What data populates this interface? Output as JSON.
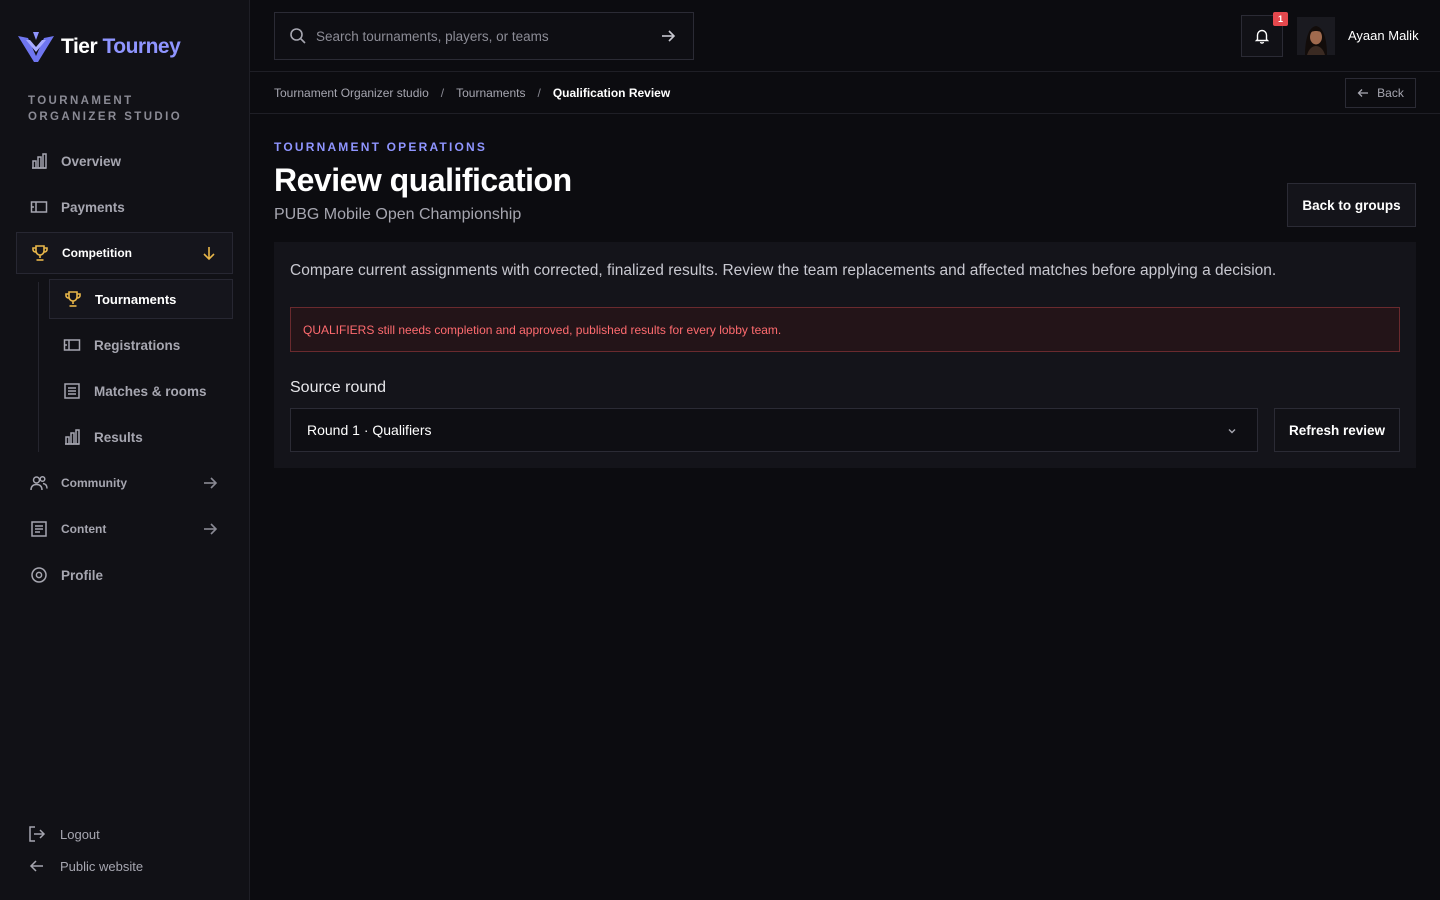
{
  "brand": {
    "name_part1": "Tier",
    "name_part2": "Tourney",
    "accent": "#8f95ff"
  },
  "sidebar": {
    "section_label": "TOURNAMENT ORGANIZER STUDIO",
    "items": [
      {
        "label": "Overview",
        "icon": "bar-chart-icon"
      },
      {
        "label": "Payments",
        "icon": "ticket-icon"
      },
      {
        "label": "Competition",
        "icon": "trophy-icon",
        "expanded": true
      },
      {
        "label": "Community",
        "icon": "users-icon"
      },
      {
        "label": "Content",
        "icon": "document-icon"
      },
      {
        "label": "Profile",
        "icon": "settings-icon"
      }
    ],
    "competition_sub": [
      {
        "label": "Tournaments",
        "icon": "trophy-icon",
        "active": true
      },
      {
        "label": "Registrations",
        "icon": "ticket-icon"
      },
      {
        "label": "Matches & rooms",
        "icon": "list-icon"
      },
      {
        "label": "Results",
        "icon": "bar-chart-icon"
      }
    ],
    "footer": {
      "logout": "Logout",
      "public_site": "Public website"
    }
  },
  "header": {
    "search_placeholder": "Search tournaments, players, or teams",
    "notification_count": "1",
    "user_name": "Ayaan Malik"
  },
  "breadcrumb": {
    "items": [
      "Tournament Organizer studio",
      "Tournaments",
      "Qualification Review"
    ],
    "separator": "/",
    "back_label": "Back"
  },
  "main": {
    "eyebrow": "TOURNAMENT OPERATIONS",
    "title": "Review qualification",
    "subtitle": "PUBG Mobile Open Championship",
    "back_to_groups": "Back to groups",
    "description": "Compare current assignments with corrected, finalized results. Review the team replacements and affected matches before applying a decision.",
    "alert": "QUALIFIERS still needs completion and approved, published results for every lobby team.",
    "source_round_label": "Source round",
    "source_round_value": "Round 1 · Qualifiers",
    "refresh_label": "Refresh review"
  },
  "colors": {
    "background": "#0c0c10",
    "panel": "#14141a",
    "danger": "#ff6b6f",
    "badge": "#e5484d",
    "trophy": "#e8b64a"
  }
}
